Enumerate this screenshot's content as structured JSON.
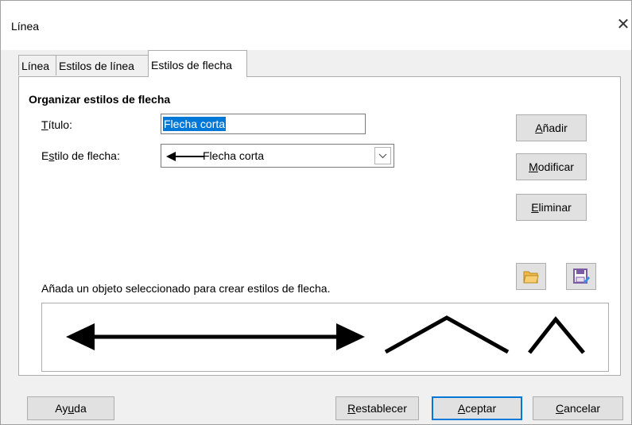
{
  "window": {
    "title": "Línea",
    "close_glyph": "✕"
  },
  "tabs": [
    {
      "label": "Línea",
      "active": false
    },
    {
      "label": "Estilos de línea",
      "active": false
    },
    {
      "label": "Estilos de flecha",
      "active": true
    }
  ],
  "section": {
    "title": "Organizar estilos de flecha"
  },
  "fields": {
    "title_label_u": "T",
    "title_label_rest": "ítulo:",
    "title_value": "Flecha corta",
    "style_label_pre": "E",
    "style_label_u": "s",
    "style_label_rest": "tilo de flecha:",
    "style_value": "Flecha corta"
  },
  "buttons": {
    "add_pre": "",
    "add_u": "A",
    "add_rest": "ñadir",
    "modify_pre": "",
    "modify_u": "M",
    "modify_rest": "odificar",
    "delete_pre": "",
    "delete_u": "E",
    "delete_rest": "liminar"
  },
  "icons": {
    "open": "folder-open-icon",
    "save": "save-icon"
  },
  "hint": "Añada un objeto seleccionado para crear estilos de flecha.",
  "footer": {
    "help_pre": "Ay",
    "help_u": "u",
    "help_rest": "da",
    "reset_pre": "",
    "reset_u": "R",
    "reset_rest": "establecer",
    "ok_pre": "",
    "ok_u": "A",
    "ok_rest": "ceptar",
    "cancel_pre": "",
    "cancel_u": "C",
    "cancel_rest": "ancelar"
  },
  "colors": {
    "accent": "#0078d7",
    "button_bg": "#e1e1e1",
    "dialog_bg": "#f0f0f0",
    "folder": "#f0b84a",
    "save": "#7b5aa6"
  }
}
